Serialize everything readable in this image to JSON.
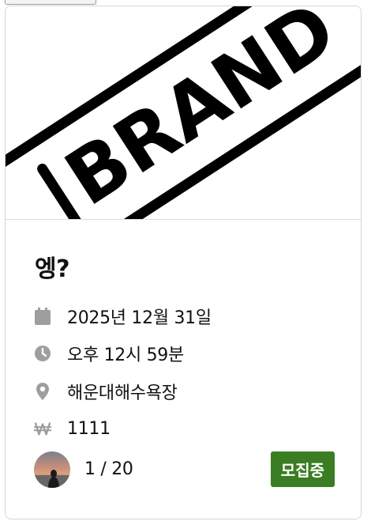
{
  "card": {
    "banner_text": "BRAND",
    "title": "엥?",
    "date": "2025년 12월 31일",
    "time": "오후 12시 59분",
    "place": "해운대해수욕장",
    "price": "1111",
    "participants": "1 / 20",
    "status": "모집중"
  },
  "colors": {
    "status_bg": "#3a7d22",
    "icon_gray": "#9e9e9e"
  },
  "icons": [
    "calendar-icon",
    "clock-icon",
    "location-pin-icon",
    "won-icon"
  ]
}
